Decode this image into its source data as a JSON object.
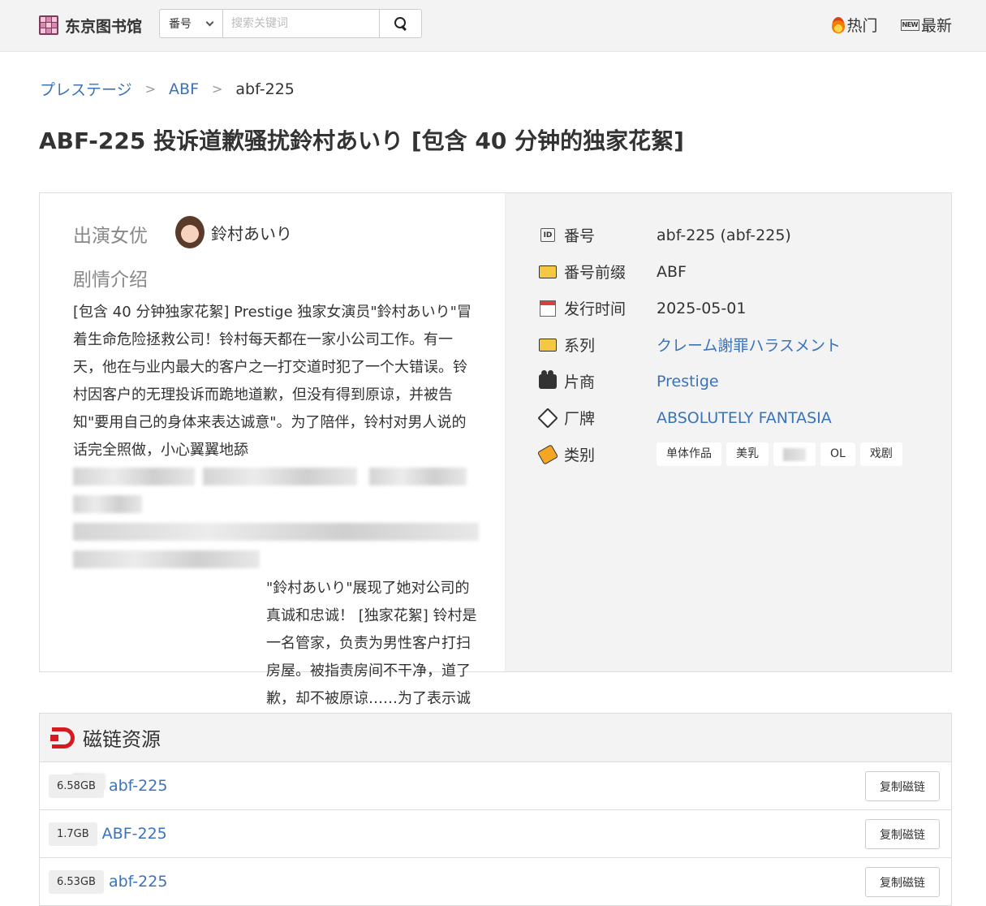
{
  "header": {
    "logo_text": "东京图书馆",
    "search_type": "番号",
    "search_placeholder": "搜索关键词",
    "nav": [
      {
        "label": "热门",
        "icon": "fire-icon"
      },
      {
        "label": "最新",
        "icon": "new-badge-icon"
      }
    ],
    "new_badge_text": "NEW"
  },
  "breadcrumb": [
    {
      "label": "プレステージ"
    },
    {
      "label": "ABF"
    },
    {
      "label": "abf-225"
    }
  ],
  "breadcrumb_sep": ">",
  "title": "ABF-225 投诉道歉骚扰鈴村あいり [包含 40 分钟的独家花絮]",
  "info": {
    "actor_label": "出演女优",
    "actor_name": "鈴村あいり",
    "plot_label": "剧情介绍",
    "plot_part1": "[包含 40 分钟独家花絮] Prestige 独家女演员\"鈴村あいり\"冒着生命危险拯救公司！铃村每天都在一家小公司工作。有一天，他在与业内最大的客户之一打交道时犯了一个大错误。铃村因客户的无理投诉而跪地道歉，但没有得到原谅，并被告知\"要用自己的身体来表达诚意\"。为了陪伴，铃村对男人说的话完全照做，小心翼翼地舔",
    "plot_part2": "\"鈴村あいり\"展现了她对公司的真诚和忠诚！ [独家花絮] 铃村是一名管家，负责为男性客户打扫房屋。被指责房间不干净，道了歉，却不被原谅……为了表示诚意，她与变态男顾客发生了激情的",
    "meta": [
      {
        "icon": "id-icon",
        "key": "番号",
        "value": "abf-225 (abf-225)",
        "link": false
      },
      {
        "icon": "folder-icon",
        "key": "番号前缀",
        "value": "ABF",
        "link": false
      },
      {
        "icon": "calendar-icon",
        "key": "发行时间",
        "value": "2025-05-01",
        "link": false
      },
      {
        "icon": "folder-icon",
        "key": "系列",
        "value": "クレーム謝罪ハラスメント",
        "link": true
      },
      {
        "icon": "camera-icon",
        "key": "片商",
        "value": "Prestige",
        "link": true
      },
      {
        "icon": "tag-icon",
        "key": "厂牌",
        "value": "ABSOLUTELY FANTASIA",
        "link": true
      }
    ],
    "genre_key": "类别",
    "genres": [
      "单体作品",
      "美乳",
      "",
      "OL",
      "戏剧"
    ]
  },
  "magnets": {
    "title": "磁链资源",
    "copy_label": "复制磁链",
    "rows": [
      {
        "size": "6.58GB",
        "name": "abf-225"
      },
      {
        "size": "1.7GB",
        "name": "ABF-225"
      },
      {
        "size": "6.53GB",
        "name": "abf-225"
      }
    ]
  }
}
